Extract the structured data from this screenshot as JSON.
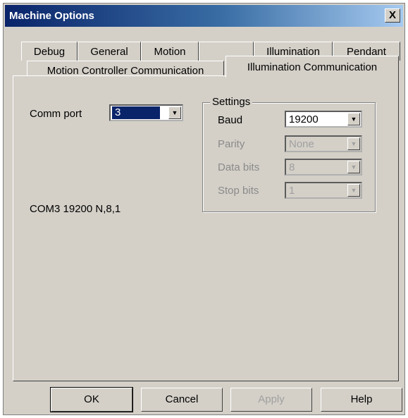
{
  "window": {
    "title": "Machine Options",
    "close_label": "X"
  },
  "tabs_row1": [
    "Debug",
    "General",
    "Motion",
    "",
    "Illumination",
    "Pendant"
  ],
  "tabs_row2": [
    "Motion Controller Communication",
    "Illumination Communication"
  ],
  "comm": {
    "label": "Comm port",
    "value": "3",
    "summary": "COM3 19200  N,8,1"
  },
  "settings": {
    "legend": "Settings",
    "baud_label": "Baud",
    "baud_value": "19200",
    "parity_label": "Parity",
    "parity_value": "None",
    "databits_label": "Data bits",
    "databits_value": "8",
    "stopbits_label": "Stop bits",
    "stopbits_value": "1"
  },
  "buttons": {
    "ok": "OK",
    "cancel": "Cancel",
    "apply": "Apply",
    "help": "Help"
  },
  "colors": {
    "face": "#d4d0c8",
    "title_start": "#0a246a",
    "title_end": "#a6caf0",
    "selection": "#0a246a"
  },
  "icons": {
    "combo_arrow": "chevron-down-icon",
    "close": "close-icon"
  }
}
